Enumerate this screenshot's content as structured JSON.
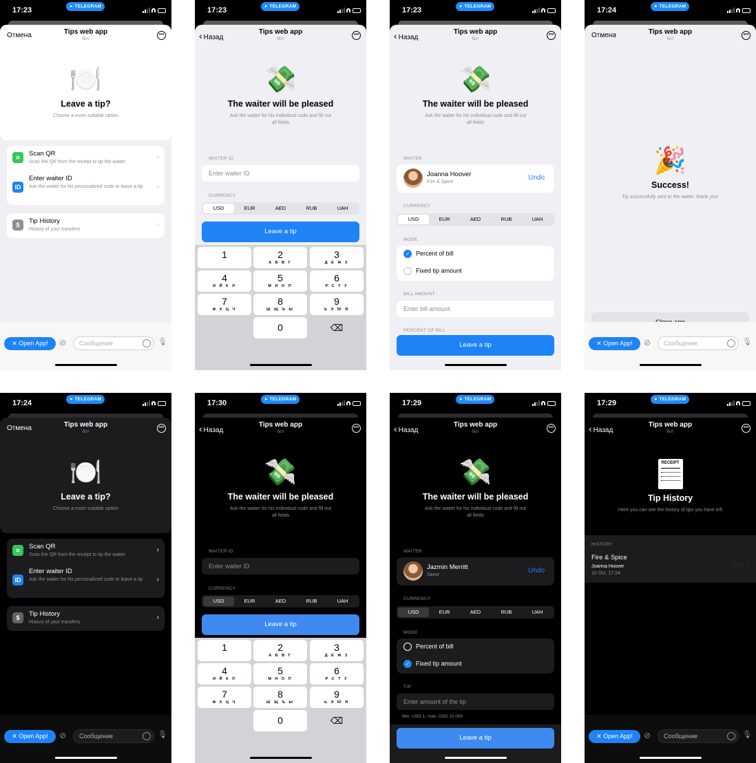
{
  "status": {
    "times": [
      "17:23",
      "17:23",
      "17:23",
      "17:24",
      "17:24",
      "17:30",
      "17:29",
      "17:29"
    ],
    "telegram_label": "TELEGRAM"
  },
  "nav": {
    "cancel": "Отмена",
    "back": "Назад",
    "title": "Tips web app",
    "subtitle": "бот",
    "more_icon": "ellipsis-circle-icon"
  },
  "home": {
    "emoji": "🍽️",
    "heading": "Leave a tip?",
    "description": "Choose a more suitable option",
    "items": [
      {
        "icon": "qr-scan-icon",
        "icon_text": "⌗",
        "title": "Scan QR",
        "desc": "Scan the QR from the receipt to tip the waiter"
      },
      {
        "icon": "id-badge-icon",
        "icon_text": "ID",
        "title": "Enter waiter ID",
        "desc": "Ask the waiter for his personalized code to leave a tip"
      },
      {
        "icon": "dollar-icon",
        "icon_text": "$",
        "title": "Tip History",
        "desc": "History of your transfers"
      }
    ]
  },
  "waiter": {
    "emoji": "💸",
    "heading": "The waiter will be pleased",
    "description": "Ask the waiter for his individual code and fill out all fields",
    "waiter_id_label": "WAITER ID",
    "waiter_id_placeholder": "Enter waiter ID",
    "currency_label": "CURRENCY",
    "currencies": [
      "USD",
      "EUR",
      "AED",
      "RUB",
      "UAH"
    ],
    "leave_tip": "Leave a tip",
    "waiter_label": "WAITER",
    "mode_label": "MODE",
    "percent_mode": "Percent of bill",
    "fixed_mode": "Fixed tip amount",
    "bill_label": "BILL AMOUNT",
    "bill_placeholder": "Enter bill amount",
    "percent_label": "PERCENT OF BILL",
    "tip_label": "TIP",
    "tip_placeholder": "Enter amount of the tip",
    "tip_hint": "Min: USD 1, max: USD 10 000",
    "undo": "Undo",
    "waiters": [
      {
        "name": "Joanna Hoover",
        "place": "Fire & Spice"
      },
      {
        "name": "Jazmin Merritt",
        "place": "Savor"
      }
    ]
  },
  "keypad": [
    {
      "n": "1",
      "l": ""
    },
    {
      "n": "2",
      "l": "А Б В Г"
    },
    {
      "n": "3",
      "l": "Д Е Ж З"
    },
    {
      "n": "4",
      "l": "И Й К Л"
    },
    {
      "n": "5",
      "l": "М Н О П"
    },
    {
      "n": "6",
      "l": "Р С Т У"
    },
    {
      "n": "7",
      "l": "Ф Х Ц Ч"
    },
    {
      "n": "8",
      "l": "Ш Щ Ъ Ы"
    },
    {
      "n": "9",
      "l": "Ь Э Ю Я"
    },
    {
      "n": "0",
      "l": ""
    }
  ],
  "keypad_delete": "⌫",
  "success": {
    "emoji": "🎉",
    "heading": "Success!",
    "description": "Tip successfully sent to the waiter, thank you!",
    "close": "Close app"
  },
  "history": {
    "receipt_title": "RECEIPT",
    "heading": "Tip History",
    "description": "Here you can see the history of tips you have left",
    "label": "HISTORY",
    "entry": {
      "place": "Fire & Spice",
      "name": "Joanna Hoover",
      "date": "10 Oct, 17:24",
      "amount": "USD 1"
    }
  },
  "composer": {
    "open_app": "✕ Open App!",
    "placeholder": "Сообщение"
  },
  "colors": {
    "accent": "#1e83f7",
    "light_bg": "#efeff4",
    "dark_bg": "#000000",
    "dark_card": "#1c1c1e"
  }
}
